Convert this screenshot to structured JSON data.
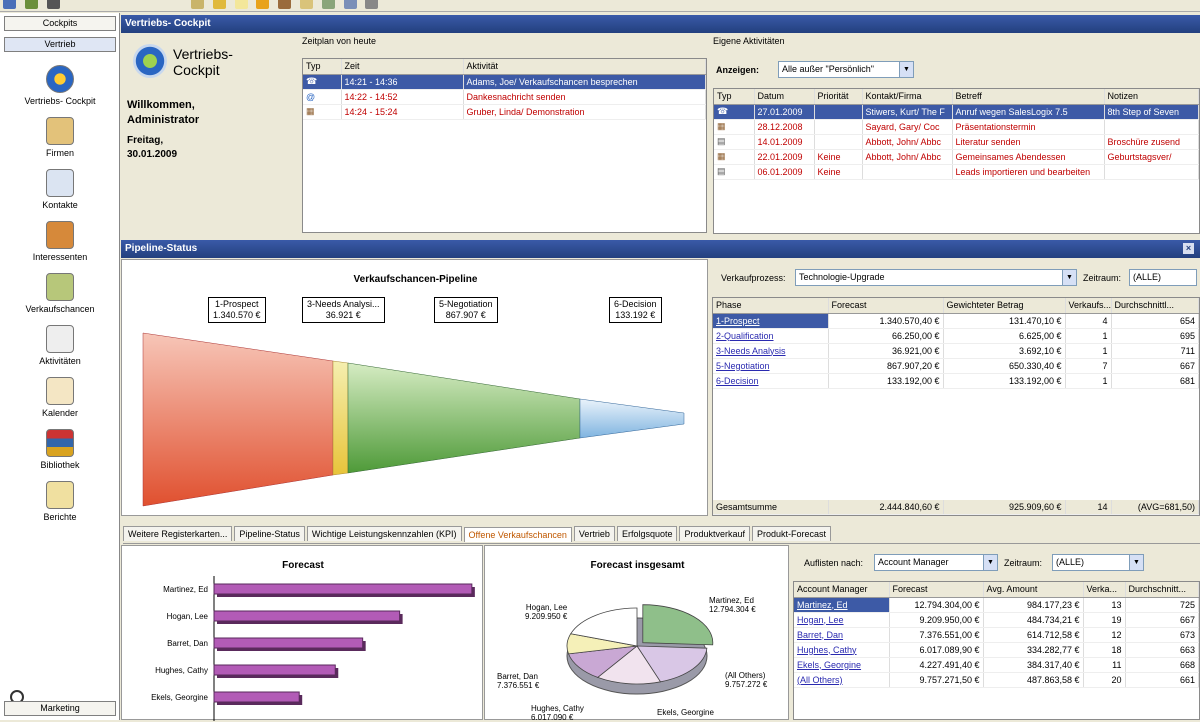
{
  "nav": {
    "top_buttons": [
      "Cockpits",
      "Vertrieb"
    ],
    "items": [
      "Vertriebs- Cockpit",
      "Firmen",
      "Kontakte",
      "Interessenten",
      "Verkaufschancen",
      "Aktivitäten",
      "Kalender",
      "Bibliothek",
      "Berichte"
    ],
    "bottom_button": "Marketing"
  },
  "cockpit": {
    "title": "Vertriebs- Cockpit",
    "logo_title": "Vertriebs-\nCockpit",
    "welcome": "Willkommen,\nAdministrator",
    "date": "Freitag,\n30.01.2009"
  },
  "schedule": {
    "header": "Zeitplan von heute",
    "columns": [
      "Typ",
      "Zeit",
      "Aktivität"
    ],
    "rows": [
      {
        "time": "14:21 - 14:36",
        "activity": "Adams, Joe/ Verkaufschancen besprechen"
      },
      {
        "time": "14:22 - 14:52",
        "activity": "Dankesnachricht senden"
      },
      {
        "time": "14:24 - 15:24",
        "activity": "Gruber, Linda/ Demonstration"
      }
    ]
  },
  "own_activities": {
    "header": "Eigene Aktivitäten",
    "show_label": "Anzeigen:",
    "show_value": "Alle außer \"Persönlich\"",
    "columns": [
      "Typ",
      "Datum",
      "Priorität",
      "Kontakt/Firma",
      "Betreff",
      "Notizen"
    ],
    "rows": [
      {
        "date": "27.01.2009",
        "priority": "",
        "contact": "Stiwers, Kurt/ The F",
        "subject": "Anruf wegen SalesLogix 7.5",
        "notes": "8th Step of Seven"
      },
      {
        "date": "28.12.2008",
        "priority": "",
        "contact": "Sayard, Gary/ Coc",
        "subject": "Präsentationstermin",
        "notes": ""
      },
      {
        "date": "14.01.2009",
        "priority": "",
        "contact": "Abbott, John/ Abbc",
        "subject": "Literatur senden",
        "notes": "Broschüre zusend"
      },
      {
        "date": "22.01.2009",
        "priority": "Keine",
        "contact": "Abbott, John/ Abbc",
        "subject": "Gemeinsames Abendessen",
        "notes": "Geburtstagsver/"
      },
      {
        "date": "06.01.2009",
        "priority": "Keine",
        "contact": "",
        "subject": "Leads importieren und bearbeiten",
        "notes": ""
      }
    ]
  },
  "pipeline": {
    "section_title": "Pipeline-Status",
    "chart_title": "Verkaufschancen-Pipeline",
    "stages": [
      {
        "name": "1-Prospect",
        "value": "1.340.570 €"
      },
      {
        "name": "3-Needs Analysi...",
        "value": "36.921 €"
      },
      {
        "name": "5-Negotiation",
        "value": "867.907 €"
      },
      {
        "name": "6-Decision",
        "value": "133.192 €"
      }
    ],
    "process_label": "Verkaufprozess:",
    "process_value": "Technologie-Upgrade",
    "period_label": "Zeitraum:",
    "period_value": "(ALLE)",
    "columns": [
      "Phase",
      "Forecast",
      "Gewichteter Betrag",
      "Verkaufs...",
      "Durchschnittl..."
    ],
    "rows": [
      [
        "1-Prospect",
        "1.340.570,40 €",
        "131.470,10 €",
        "4",
        "654"
      ],
      [
        "2-Qualification",
        "66.250,00 €",
        "6.625,00 €",
        "1",
        "695"
      ],
      [
        "3-Needs Analysis",
        "36.921,00 €",
        "3.692,10 €",
        "1",
        "711"
      ],
      [
        "5-Negotiation",
        "867.907,20 €",
        "650.330,40 €",
        "7",
        "667"
      ],
      [
        "6-Decision",
        "133.192,00 €",
        "133.192,00 €",
        "1",
        "681"
      ]
    ],
    "total": [
      "Gesamtsumme",
      "2.444.840,60 €",
      "925.909,60 €",
      "14",
      "(AVG=681,50)"
    ]
  },
  "tabs": [
    "Weitere Registerkarten...",
    "Pipeline-Status",
    "Wichtige Leistungskennzahlen (KPI)",
    "Offene Verkaufschancen",
    "Vertrieb",
    "Erfolgsquote",
    "Produktverkauf",
    "Produkt-Forecast"
  ],
  "forecast_chart": {
    "title": "Forecast"
  },
  "pie_chart": {
    "title": "Forecast insgesamt",
    "labels": [
      {
        "name": "Martinez, Ed",
        "value": "12.794.304 €"
      },
      {
        "name": "Hogan, Lee",
        "value": "9.209.950 €"
      },
      {
        "name": "Barret, Dan",
        "value": "7.376.551 €"
      },
      {
        "name": "Hughes, Cathy",
        "value": "6.017.090 €"
      },
      {
        "name": "Ekels, Georgine",
        "value": ""
      },
      {
        "name": "(All Others)",
        "value": "9.757.272 €"
      }
    ]
  },
  "account_table": {
    "list_label": "Auflisten nach:",
    "list_value": "Account Manager",
    "period_label": "Zeitraum:",
    "period_value": "(ALLE)",
    "columns": [
      "Account Manager",
      "Forecast",
      "Avg. Amount",
      "Verka...",
      "Durchschnitt..."
    ],
    "rows": [
      [
        "Martinez, Ed",
        "12.794.304,00 €",
        "984.177,23 €",
        "13",
        "725"
      ],
      [
        "Hogan, Lee",
        "9.209.950,00 €",
        "484.734,21 €",
        "19",
        "667"
      ],
      [
        "Barret, Dan",
        "7.376.551,00 €",
        "614.712,58 €",
        "12",
        "673"
      ],
      [
        "Hughes, Cathy",
        "6.017.089,90 €",
        "334.282,77 €",
        "18",
        "663"
      ],
      [
        "Ekels, Georgine",
        "4.227.491,40 €",
        "384.317,40 €",
        "11",
        "668"
      ],
      [
        "(All Others)",
        "9.757.271,50 €",
        "487.863,58 €",
        "20",
        "661"
      ]
    ]
  },
  "chart_data": [
    {
      "type": "bar",
      "title": "Forecast",
      "categories": [
        "Martinez, Ed",
        "Hogan, Lee",
        "Barret, Dan",
        "Hughes, Cathy",
        "Ekels, Georgine"
      ],
      "values": [
        12794304,
        9209950,
        7376551,
        6017090,
        4227491
      ],
      "orientation": "horizontal"
    },
    {
      "type": "pie",
      "title": "Forecast insgesamt",
      "categories": [
        "Martinez, Ed",
        "Hogan, Lee",
        "Barret, Dan",
        "Hughes, Cathy",
        "Ekels, Georgine",
        "(All Others)"
      ],
      "values": [
        12794304,
        9209950,
        7376551,
        6017090,
        4227491,
        9757272
      ]
    }
  ],
  "colors": {
    "title_bar": "#2f4c92",
    "selection": "#3d5aa6",
    "red_text": "#c00000",
    "bar": "#b25bb6"
  }
}
